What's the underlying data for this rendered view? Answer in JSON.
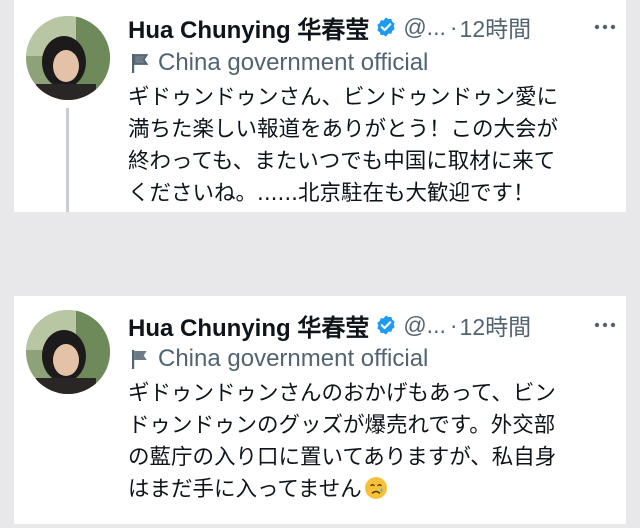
{
  "tweets": [
    {
      "name": "Hua Chunying 华春莹",
      "handle": "@...",
      "separator": "·",
      "time": "12時間",
      "label": "China government official",
      "text": "ギドゥンドゥンさん、ビンドゥンドゥン愛に\n満ちた楽しい報道をありがとう！この大会が\n終わっても、またいつでも中国に取材に来て\nくださいね。......北京駐在も大歓迎です！",
      "avatar_icon": "profile-photo",
      "verified_icon": "verified-badge-icon",
      "label_icon": "flag-icon",
      "more_icon": "more-options-icon"
    },
    {
      "name": "Hua Chunying 华春莹",
      "handle": "@...",
      "separator": "·",
      "time": "12時間",
      "label": "China government official",
      "text": "ギドゥンドゥンさんのおかげもあって、ビン\nドゥンドゥンのグッズが爆売れです。外交部\nの藍庁の入り口に置いてありますが、私自身\nはまだ手に入ってません",
      "emoji": "crying-face",
      "avatar_icon": "profile-photo",
      "verified_icon": "verified-badge-icon",
      "label_icon": "flag-icon",
      "more_icon": "more-options-icon"
    }
  ],
  "colors": {
    "background": "#e8e8ea",
    "card": "#ffffff",
    "primary_text": "#0f1419",
    "secondary_text": "#536471",
    "verified": "#1d9bf0",
    "thread_line": "#c9ccd1"
  }
}
